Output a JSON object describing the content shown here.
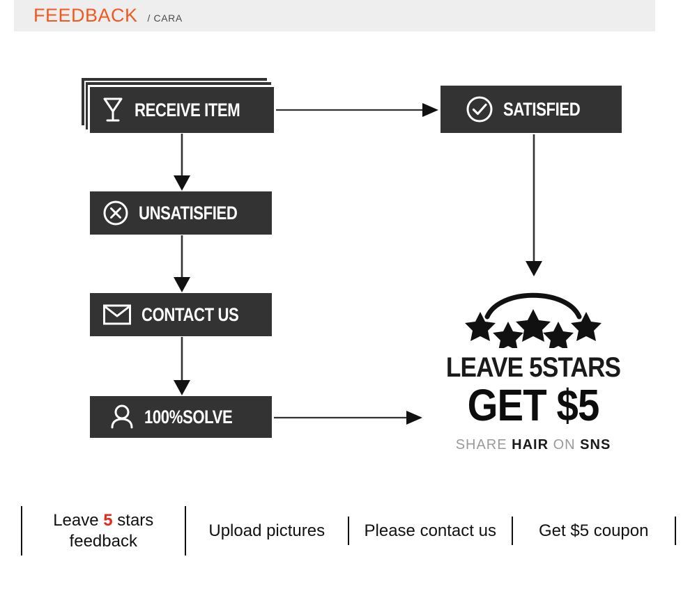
{
  "header": {
    "title": "FEEDBACK",
    "subtitle": "/ CARA",
    "title_color": "#f05a1e",
    "subtitle_color": "#4a4a4a",
    "bar_color": "#eeeeee"
  },
  "flow": {
    "box_bg": "#333333",
    "box_text_color": "#ffffff",
    "boxes": [
      {
        "id": "receive-item",
        "label": "RECEIVE ITEM",
        "icon": "wine-glass-icon",
        "stacked": true
      },
      {
        "id": "unsatisfied",
        "label": "UNSATISFIED",
        "icon": "x-circle-icon",
        "stacked": false
      },
      {
        "id": "contact-us",
        "label": "CONTACT US",
        "icon": "envelope-icon",
        "stacked": false
      },
      {
        "id": "solve",
        "label": "100%SOLVE",
        "icon": "person-icon",
        "stacked": false
      },
      {
        "id": "satisfied",
        "label": "SATISFIED",
        "icon": "check-circle-icon",
        "stacked": false
      }
    ],
    "arrows": [
      {
        "id": "receive-to-satisfied",
        "direction": "right"
      },
      {
        "id": "receive-to-unsatisfied",
        "direction": "down"
      },
      {
        "id": "unsatisfied-to-contact",
        "direction": "down"
      },
      {
        "id": "contact-to-solve",
        "direction": "down"
      },
      {
        "id": "solve-to-promo",
        "direction": "right"
      },
      {
        "id": "satisfied-to-promo",
        "direction": "down"
      }
    ]
  },
  "promo": {
    "stars_count": 5,
    "line1": "LEAVE 5STARS",
    "line2": "GET $5",
    "line3_parts": [
      {
        "text": "SHARE",
        "style": "dim"
      },
      {
        "text": "HAIR",
        "style": "bold"
      },
      {
        "text": "ON",
        "style": "dim"
      },
      {
        "text": "SNS",
        "style": "bold"
      }
    ],
    "line3_full": "SHARE HAIR ON SNS"
  },
  "bottom_strip": {
    "cells": [
      {
        "id": "leave-5-stars-feedback",
        "pre": "Leave ",
        "accent": "5",
        "post": " stars feedback"
      },
      {
        "id": "upload-pictures",
        "text": "Upload pictures"
      },
      {
        "id": "please-contact-us",
        "text": "Please contact us"
      },
      {
        "id": "get-5-coupon",
        "text": "Get $5 coupon"
      }
    ],
    "accent_color": "#e02b1d"
  }
}
